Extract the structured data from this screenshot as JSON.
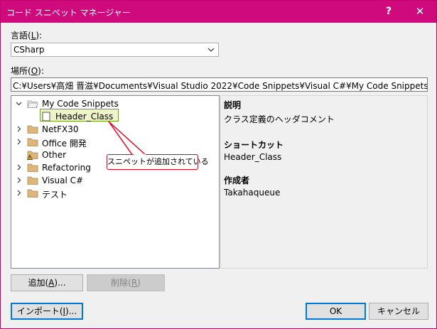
{
  "window": {
    "title": "コード スニペット マネージャー",
    "help_label": "?",
    "close_label": "✕"
  },
  "language": {
    "label_prefix": "言語(",
    "label_key": "L",
    "label_suffix": "):",
    "selected": "CSharp"
  },
  "location": {
    "label_prefix": "場所(",
    "label_key": "O",
    "label_suffix": "):",
    "path": "C:¥Users¥高畑 晋滋¥Documents¥Visual Studio 2022¥Code Snippets¥Visual C#¥My Code Snippets¥Header_Class.snippet"
  },
  "tree": {
    "items": [
      {
        "label": "My Code Snippets",
        "expanded": true,
        "icon": "folder-open-icon"
      },
      {
        "label": "Header_Class",
        "icon": "snippet-file-icon",
        "selected": true
      },
      {
        "label": "NetFX30",
        "expanded": false,
        "icon": "folder-icon"
      },
      {
        "label": "Office 開発",
        "expanded": false,
        "icon": "folder-icon"
      },
      {
        "label": "Other",
        "icon": "folder-warning-icon"
      },
      {
        "label": "Refactoring",
        "expanded": false,
        "icon": "folder-icon"
      },
      {
        "label": "Visual C#",
        "expanded": false,
        "icon": "folder-icon"
      },
      {
        "label": "テスト",
        "expanded": false,
        "icon": "folder-icon"
      }
    ]
  },
  "details": {
    "description_heading": "説明",
    "description_value": "クラス定義のヘッダコメント",
    "shortcut_heading": "ショートカット",
    "shortcut_value": "Header_Class",
    "author_heading": "作成者",
    "author_value": "Takahaqueue"
  },
  "buttons": {
    "add": {
      "prefix": "追加(",
      "key": "A",
      "suffix": ")..."
    },
    "remove": {
      "prefix": "削除(",
      "key": "R",
      "suffix": ")"
    },
    "import": {
      "prefix": "インポート(",
      "key": "I",
      "suffix": ")..."
    },
    "ok": "OK",
    "cancel": "キャンセル"
  },
  "annotation": {
    "text": "スニペットが追加されている"
  },
  "colors": {
    "titlebar": "#cf0a7c",
    "callout": "#e6001e",
    "selection_fill": "#eef3c9",
    "selection_border": "#6fa31c",
    "focus_border": "#0078d7"
  }
}
